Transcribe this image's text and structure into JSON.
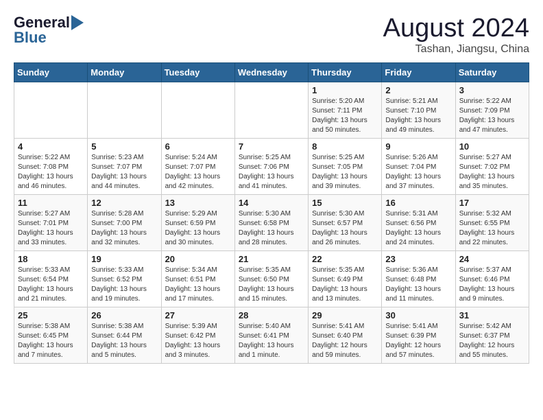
{
  "header": {
    "logo_general": "General",
    "logo_blue": "Blue",
    "month_title": "August 2024",
    "location": "Tashan, Jiangsu, China"
  },
  "weekdays": [
    "Sunday",
    "Monday",
    "Tuesday",
    "Wednesday",
    "Thursday",
    "Friday",
    "Saturday"
  ],
  "weeks": [
    [
      {
        "day": "",
        "info": ""
      },
      {
        "day": "",
        "info": ""
      },
      {
        "day": "",
        "info": ""
      },
      {
        "day": "",
        "info": ""
      },
      {
        "day": "1",
        "info": "Sunrise: 5:20 AM\nSunset: 7:11 PM\nDaylight: 13 hours\nand 50 minutes."
      },
      {
        "day": "2",
        "info": "Sunrise: 5:21 AM\nSunset: 7:10 PM\nDaylight: 13 hours\nand 49 minutes."
      },
      {
        "day": "3",
        "info": "Sunrise: 5:22 AM\nSunset: 7:09 PM\nDaylight: 13 hours\nand 47 minutes."
      }
    ],
    [
      {
        "day": "4",
        "info": "Sunrise: 5:22 AM\nSunset: 7:08 PM\nDaylight: 13 hours\nand 46 minutes."
      },
      {
        "day": "5",
        "info": "Sunrise: 5:23 AM\nSunset: 7:07 PM\nDaylight: 13 hours\nand 44 minutes."
      },
      {
        "day": "6",
        "info": "Sunrise: 5:24 AM\nSunset: 7:07 PM\nDaylight: 13 hours\nand 42 minutes."
      },
      {
        "day": "7",
        "info": "Sunrise: 5:25 AM\nSunset: 7:06 PM\nDaylight: 13 hours\nand 41 minutes."
      },
      {
        "day": "8",
        "info": "Sunrise: 5:25 AM\nSunset: 7:05 PM\nDaylight: 13 hours\nand 39 minutes."
      },
      {
        "day": "9",
        "info": "Sunrise: 5:26 AM\nSunset: 7:04 PM\nDaylight: 13 hours\nand 37 minutes."
      },
      {
        "day": "10",
        "info": "Sunrise: 5:27 AM\nSunset: 7:02 PM\nDaylight: 13 hours\nand 35 minutes."
      }
    ],
    [
      {
        "day": "11",
        "info": "Sunrise: 5:27 AM\nSunset: 7:01 PM\nDaylight: 13 hours\nand 33 minutes."
      },
      {
        "day": "12",
        "info": "Sunrise: 5:28 AM\nSunset: 7:00 PM\nDaylight: 13 hours\nand 32 minutes."
      },
      {
        "day": "13",
        "info": "Sunrise: 5:29 AM\nSunset: 6:59 PM\nDaylight: 13 hours\nand 30 minutes."
      },
      {
        "day": "14",
        "info": "Sunrise: 5:30 AM\nSunset: 6:58 PM\nDaylight: 13 hours\nand 28 minutes."
      },
      {
        "day": "15",
        "info": "Sunrise: 5:30 AM\nSunset: 6:57 PM\nDaylight: 13 hours\nand 26 minutes."
      },
      {
        "day": "16",
        "info": "Sunrise: 5:31 AM\nSunset: 6:56 PM\nDaylight: 13 hours\nand 24 minutes."
      },
      {
        "day": "17",
        "info": "Sunrise: 5:32 AM\nSunset: 6:55 PM\nDaylight: 13 hours\nand 22 minutes."
      }
    ],
    [
      {
        "day": "18",
        "info": "Sunrise: 5:33 AM\nSunset: 6:54 PM\nDaylight: 13 hours\nand 21 minutes."
      },
      {
        "day": "19",
        "info": "Sunrise: 5:33 AM\nSunset: 6:52 PM\nDaylight: 13 hours\nand 19 minutes."
      },
      {
        "day": "20",
        "info": "Sunrise: 5:34 AM\nSunset: 6:51 PM\nDaylight: 13 hours\nand 17 minutes."
      },
      {
        "day": "21",
        "info": "Sunrise: 5:35 AM\nSunset: 6:50 PM\nDaylight: 13 hours\nand 15 minutes."
      },
      {
        "day": "22",
        "info": "Sunrise: 5:35 AM\nSunset: 6:49 PM\nDaylight: 13 hours\nand 13 minutes."
      },
      {
        "day": "23",
        "info": "Sunrise: 5:36 AM\nSunset: 6:48 PM\nDaylight: 13 hours\nand 11 minutes."
      },
      {
        "day": "24",
        "info": "Sunrise: 5:37 AM\nSunset: 6:46 PM\nDaylight: 13 hours\nand 9 minutes."
      }
    ],
    [
      {
        "day": "25",
        "info": "Sunrise: 5:38 AM\nSunset: 6:45 PM\nDaylight: 13 hours\nand 7 minutes."
      },
      {
        "day": "26",
        "info": "Sunrise: 5:38 AM\nSunset: 6:44 PM\nDaylight: 13 hours\nand 5 minutes."
      },
      {
        "day": "27",
        "info": "Sunrise: 5:39 AM\nSunset: 6:42 PM\nDaylight: 13 hours\nand 3 minutes."
      },
      {
        "day": "28",
        "info": "Sunrise: 5:40 AM\nSunset: 6:41 PM\nDaylight: 13 hours\nand 1 minute."
      },
      {
        "day": "29",
        "info": "Sunrise: 5:41 AM\nSunset: 6:40 PM\nDaylight: 12 hours\nand 59 minutes."
      },
      {
        "day": "30",
        "info": "Sunrise: 5:41 AM\nSunset: 6:39 PM\nDaylight: 12 hours\nand 57 minutes."
      },
      {
        "day": "31",
        "info": "Sunrise: 5:42 AM\nSunset: 6:37 PM\nDaylight: 12 hours\nand 55 minutes."
      }
    ]
  ]
}
